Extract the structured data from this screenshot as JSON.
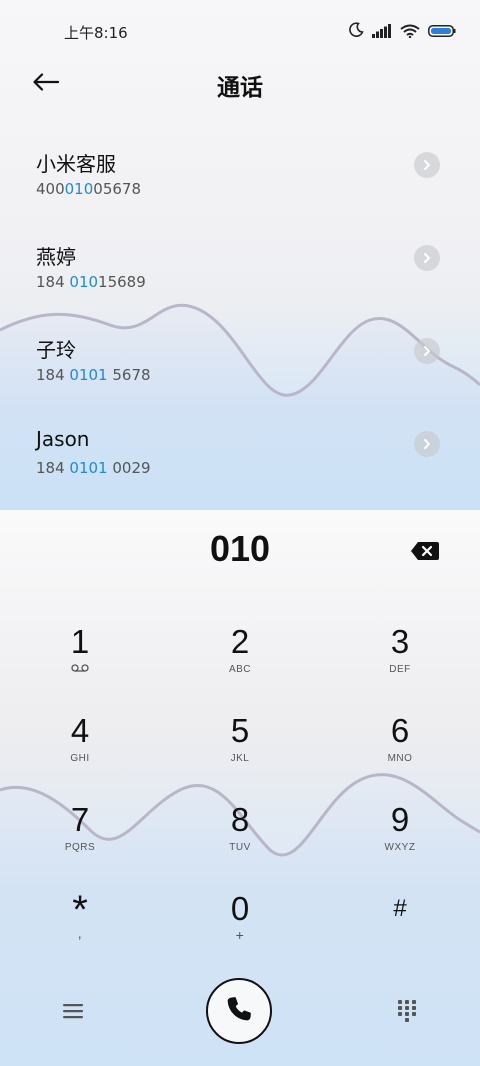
{
  "status_bar": {
    "time": "上午8:16",
    "icons": [
      "moon-icon",
      "signal-icon",
      "wifi-icon",
      "battery-icon"
    ]
  },
  "header": {
    "title": "通话",
    "back_icon": "arrow-left-icon"
  },
  "contacts": [
    {
      "name": "小米客服",
      "num_pre": "400",
      "num_hl": "010",
      "num_post": "05678"
    },
    {
      "name": "燕婷",
      "num_pre": "184 ",
      "num_hl": "010",
      "num_post": "15689"
    },
    {
      "name": "子玲",
      "num_pre": "184 ",
      "num_hl": "0101",
      "num_post": " 5678"
    },
    {
      "name": "Jason",
      "num_pre": "184 ",
      "num_hl": "0101",
      "num_post": " 0029"
    }
  ],
  "dialer": {
    "input": "010"
  },
  "keypad": [
    {
      "digit": "1",
      "letters": ""
    },
    {
      "digit": "2",
      "letters": "ABC"
    },
    {
      "digit": "3",
      "letters": "DEF"
    },
    {
      "digit": "4",
      "letters": "GHI"
    },
    {
      "digit": "5",
      "letters": "JKL"
    },
    {
      "digit": "6",
      "letters": "MNO"
    },
    {
      "digit": "7",
      "letters": "PQRS"
    },
    {
      "digit": "8",
      "letters": "TUV"
    },
    {
      "digit": "9",
      "letters": "WXYZ"
    },
    {
      "digit": "*",
      "letters": ","
    },
    {
      "digit": "0",
      "letters": "+"
    },
    {
      "digit": "#",
      "letters": ""
    }
  ],
  "colors": {
    "highlight": "#1f8ad6",
    "text": "#111111"
  }
}
